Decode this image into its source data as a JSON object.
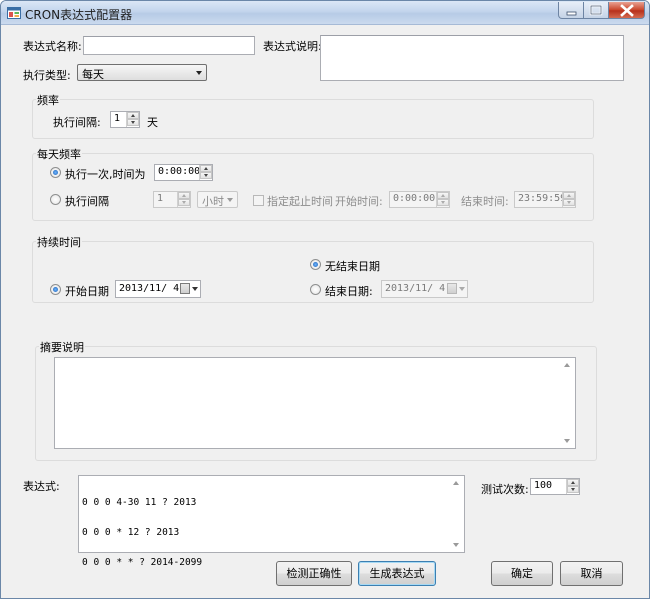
{
  "window": {
    "title": "CRON表达式配置器",
    "colors": {
      "titlebar": "#c3d5ec",
      "close_button": "#c9442a",
      "radio_accent": "#1a5fb4",
      "default_button_border": "#3c7fb1"
    }
  },
  "form": {
    "name_label": "表达式名称:",
    "name_value": "",
    "desc_label": "表达式说明:",
    "desc_value": "",
    "type_label": "执行类型:",
    "type_selected": "每天"
  },
  "frequency": {
    "title": "频率",
    "interval_label": "执行间隔:",
    "interval_value": "1",
    "unit": "天"
  },
  "daily": {
    "title": "每天频率",
    "once_label": "执行一次,时间为",
    "once_checked": true,
    "once_time": "0:00:00",
    "interval_label": "执行间隔",
    "interval_value": "1",
    "interval_unit": "小时",
    "range_check_label": "指定起止时间",
    "start_label": "开始时间:",
    "start_time": "0:00:00",
    "end_label": "结束时间:",
    "end_time": "23:59:59"
  },
  "duration": {
    "title": "持续时间",
    "start_label": "开始日期",
    "start_date": "2013/11/ 4",
    "no_end_label": "无结束日期",
    "no_end_checked": true,
    "end_label": "结束日期:",
    "end_date": "2013/11/ 4"
  },
  "summary": {
    "title": "摘要说明",
    "text": ""
  },
  "expression": {
    "label": "表达式:",
    "lines": [
      "0 0 0 4-30 11 ? 2013",
      "0 0 0 * 12 ? 2013",
      "0 0 0 * * ? 2014-2099"
    ],
    "test_count_label": "测试次数:",
    "test_count_value": "100"
  },
  "buttons": {
    "check": "检测正确性",
    "generate": "生成表达式",
    "ok": "确定",
    "cancel": "取消"
  },
  "icons": {
    "app": "app-window-icon",
    "minimize": "minimize-icon",
    "maximize": "maximize-icon",
    "close": "close-icon"
  }
}
